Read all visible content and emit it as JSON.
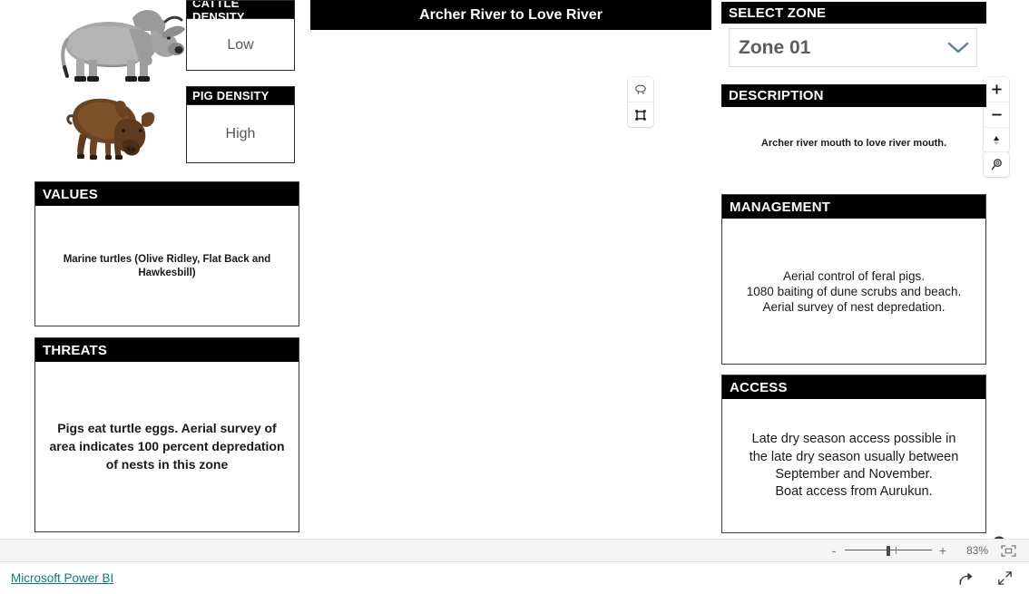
{
  "map": {
    "title": "Archer River to Love River",
    "tools": [
      {
        "name": "lasso-select-tool"
      },
      {
        "name": "box-select-tool"
      }
    ],
    "zoom_controls": [
      {
        "name": "zoom-in-button",
        "label": "+"
      },
      {
        "name": "zoom-out-button",
        "label": "−"
      },
      {
        "name": "compass-reset-button",
        "label": ""
      }
    ],
    "search_button": "map-search-button",
    "info_button": "map-info-button"
  },
  "density": {
    "cattle": {
      "title": "CATTLE DENSITY",
      "value": "Low"
    },
    "pig": {
      "title": "PIG DENSITY",
      "value": "High"
    }
  },
  "animals": {
    "cattle_image": "brahman-bull-illustration",
    "pig_image": "feral-pig-illustration"
  },
  "left_panels": [
    {
      "title": "VALUES",
      "text": "Marine turtles (Olive Ridley, Flat Back and Hawkesbill)"
    },
    {
      "title": "THREATS",
      "text": "Pigs eat turtle eggs.  Aerial survey of area indicates 100 percent depredation of nests in this zone"
    }
  ],
  "right_panels": {
    "select_zone": {
      "title": "SELECT ZONE",
      "value": "Zone 01"
    },
    "description": {
      "title": "DESCRIPTION",
      "text": "Archer river mouth to love river mouth."
    },
    "management": {
      "title": "MANAGEMENT",
      "line1": "Aerial control of feral pigs.",
      "line2": "1080 baiting of dune scrubs and beach.",
      "line3": "Aerial survey of nest depredation."
    },
    "access": {
      "title": "ACCESS",
      "line1": "Late dry season access possible in",
      "line2": "the late dry season usually between",
      "line3": "September and November.",
      "line4": "Boat access from Aurukun."
    }
  },
  "status_bar": {
    "minus": "-",
    "plus": "+",
    "zoom_percent": "83%",
    "fit_button": "fit-to-page-button"
  },
  "footer": {
    "brand_link": "Microsoft Power BI",
    "share_button": "share-button",
    "fullscreen_button": "fullscreen-button"
  },
  "colors": {
    "header_bg": "#000000",
    "link": "#0c7b7b",
    "value_text": "#585858"
  }
}
